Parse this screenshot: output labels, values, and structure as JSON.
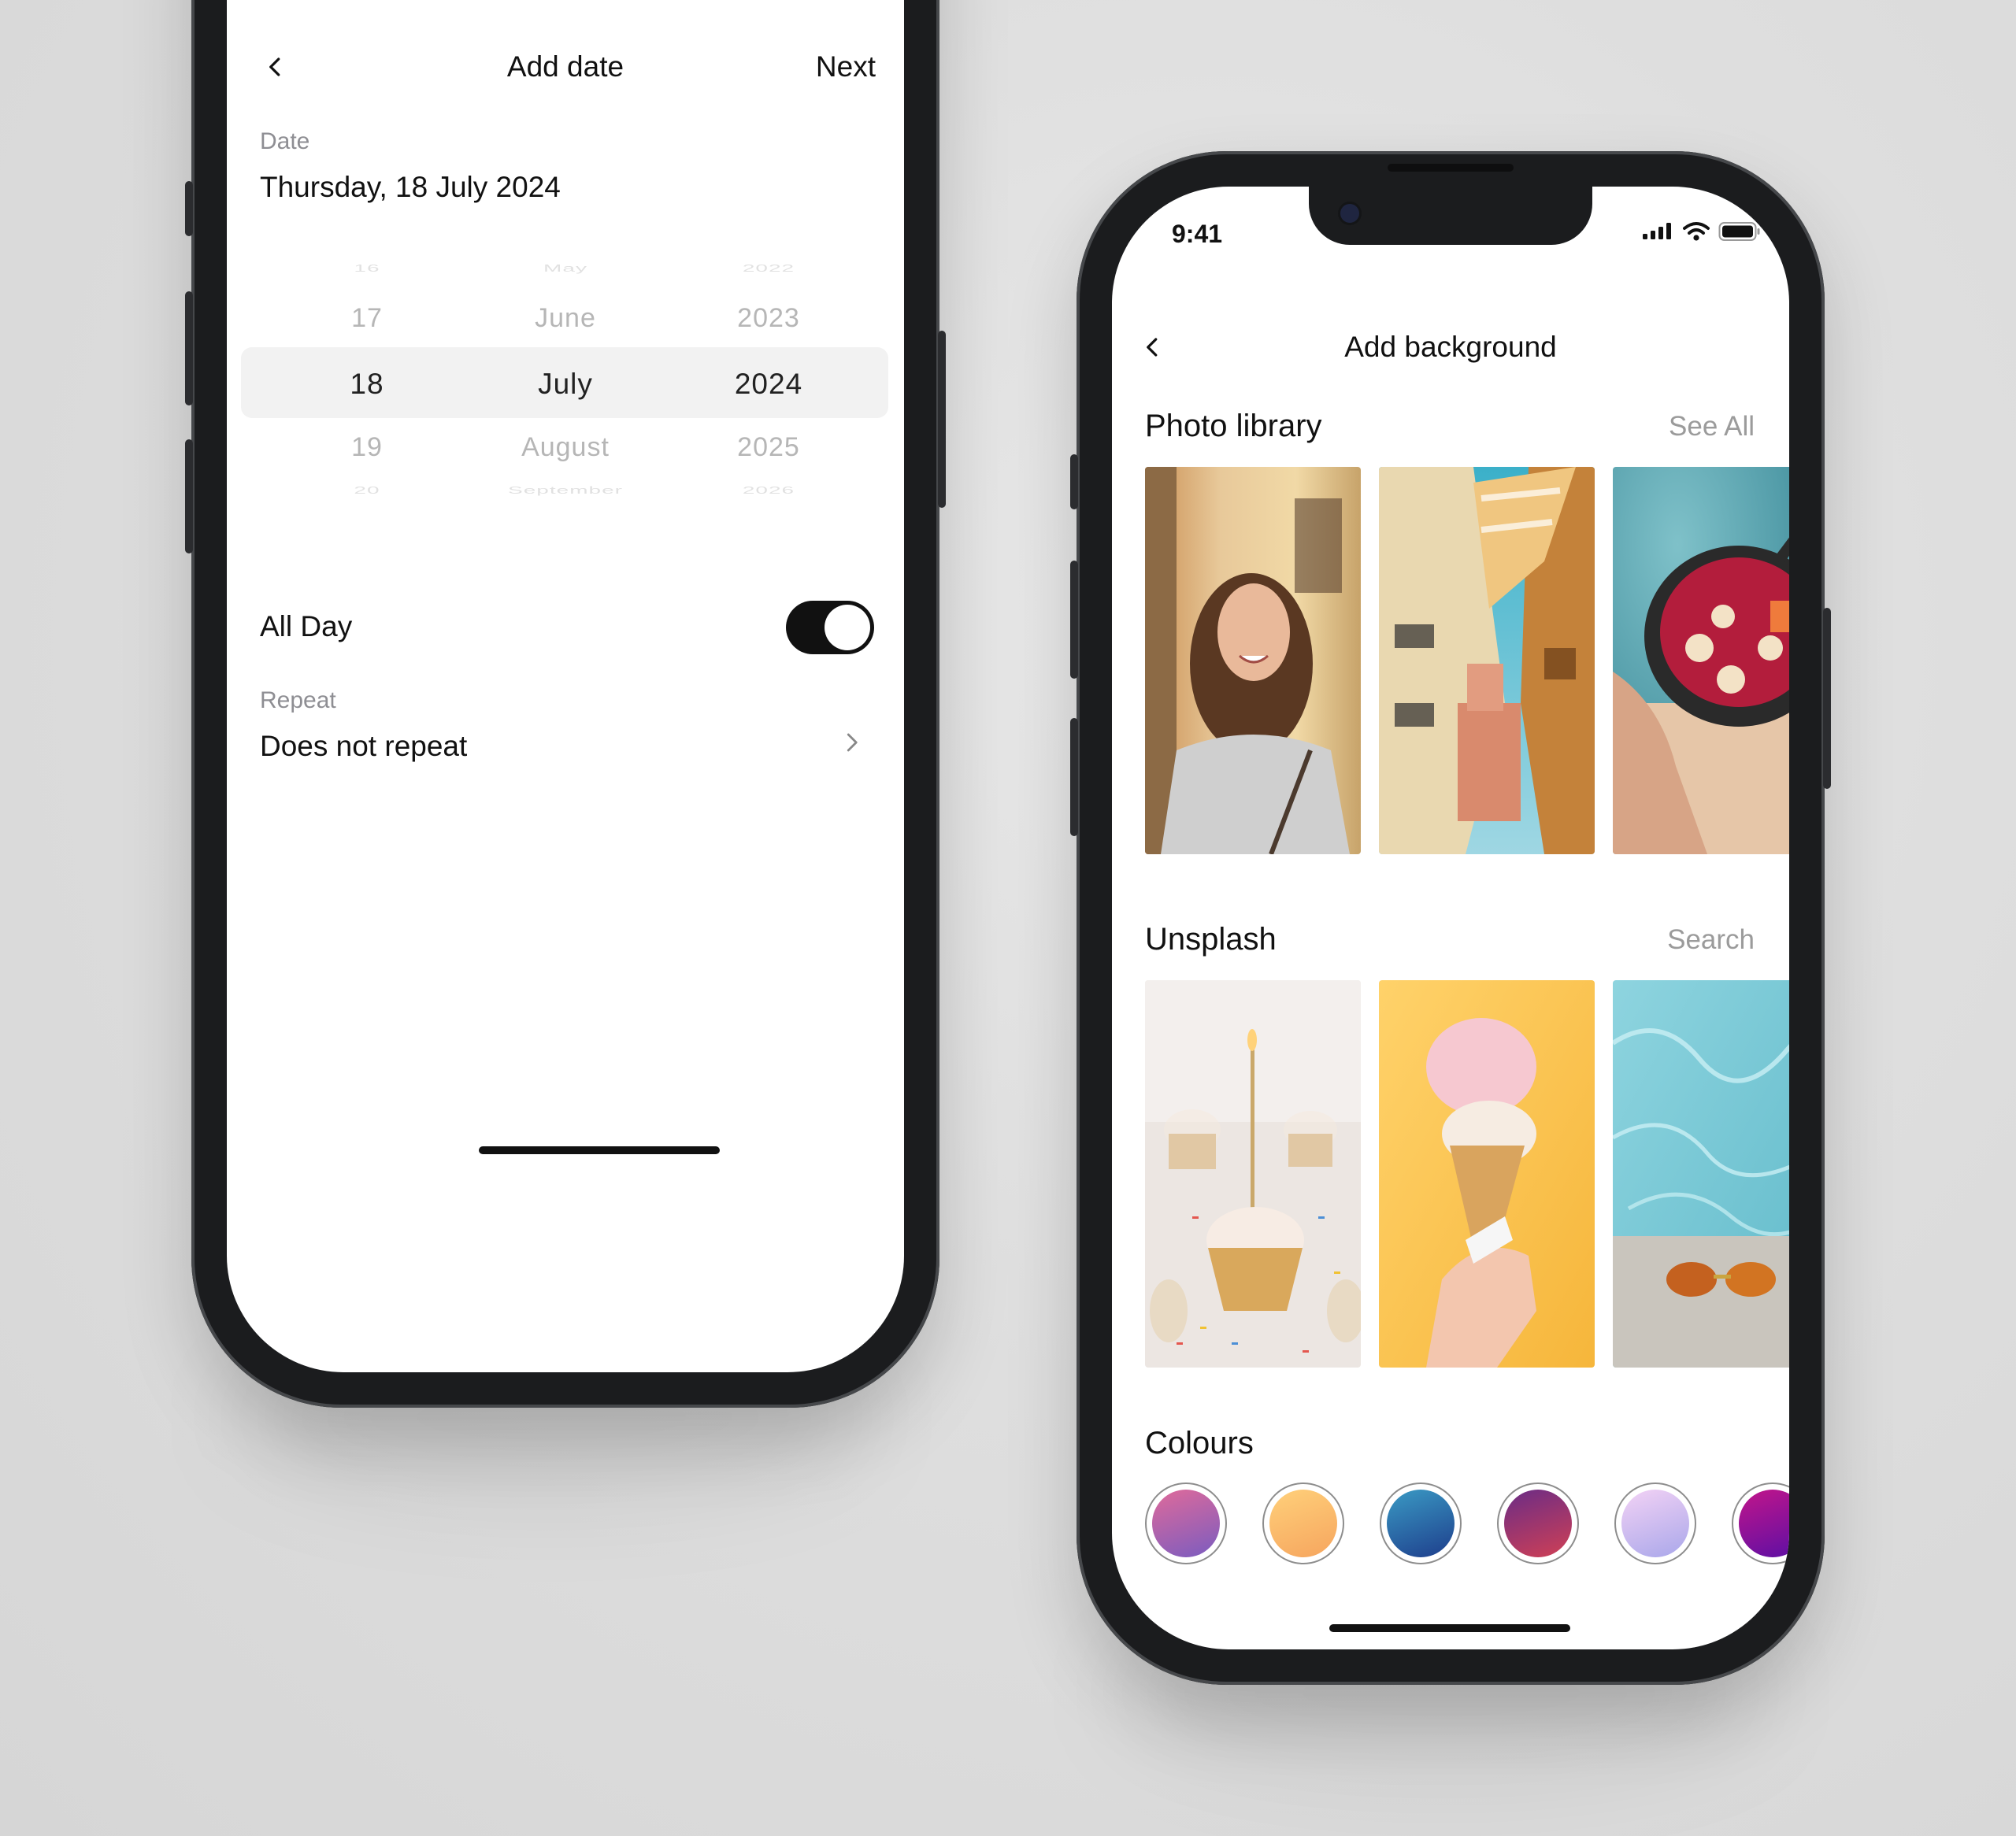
{
  "left_screen": {
    "nav": {
      "title": "Add date",
      "next_label": "Next"
    },
    "date": {
      "label": "Date",
      "value": "Thursday, 18 July 2024"
    },
    "picker": {
      "days": [
        "16",
        "17",
        "18",
        "19",
        "20"
      ],
      "months": [
        "May",
        "June",
        "July",
        "August",
        "September"
      ],
      "years": [
        "2022",
        "2023",
        "2024",
        "2025",
        "2026"
      ],
      "selected": {
        "day": "18",
        "month": "July",
        "year": "2024"
      }
    },
    "all_day": {
      "label": "All Day",
      "on": true
    },
    "repeat": {
      "label": "Repeat",
      "value": "Does not repeat"
    }
  },
  "right_screen": {
    "status": {
      "time": "9:41"
    },
    "nav": {
      "title": "Add background"
    },
    "photo_library": {
      "title": "Photo library",
      "link": "See All",
      "photos": [
        "woman-smiling-street",
        "old-town-buildings",
        "fruit-bowl"
      ]
    },
    "unsplash": {
      "title": "Unsplash",
      "link": "Search",
      "photos": [
        "birthday-cupcakes",
        "ice-cream-cone",
        "pool-sunglasses"
      ]
    },
    "colours": {
      "title": "Colours",
      "swatches": [
        {
          "name": "violet-pink",
          "from": "#e06a9a",
          "to": "#7a5cc0"
        },
        {
          "name": "peach-orange",
          "from": "#ffd07a",
          "to": "#f6a55e"
        },
        {
          "name": "ocean-blue",
          "from": "#3a9ac4",
          "to": "#1e3e8c"
        },
        {
          "name": "plum-red",
          "from": "#6a2c86",
          "to": "#d04055"
        },
        {
          "name": "lavender",
          "from": "#f3d2f5",
          "to": "#a9a7ea"
        },
        {
          "name": "magenta-purple",
          "from": "#c2158a",
          "to": "#5a0fa5"
        }
      ]
    }
  }
}
